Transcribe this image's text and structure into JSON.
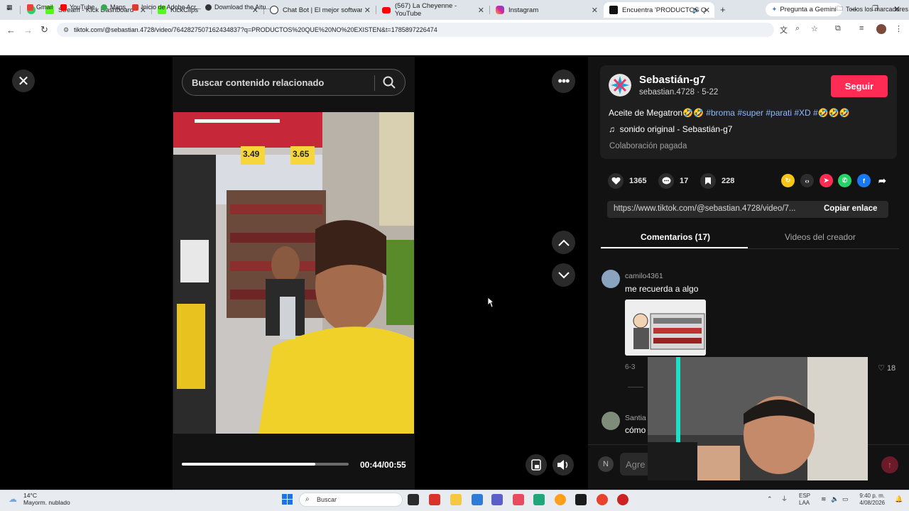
{
  "browser": {
    "tabs": [
      {
        "label": "Stream - Kick Dashboard",
        "color": "#53fc18"
      },
      {
        "label": "KickClips",
        "color": "#53fc18"
      },
      {
        "label": "Chat Bot | El mejor software pa",
        "color": "#222222"
      },
      {
        "label": "(567) La Cheyenne - YouTube",
        "color": "#ff0000"
      },
      {
        "label": "Instagram",
        "color": "#d6249f"
      },
      {
        "label": "Encuentra 'PRODUCTOS Q",
        "color": "#111111"
      }
    ],
    "gemini_label": "Pregunta a Gemini",
    "url": "tiktok.com/@sebastian.4728/video/7642827507162434837?q=PRODUCTOS%20QUE%20NO%20EXISTEN&t=1785897226474",
    "bookmarks": [
      "Gmail",
      "YouTube",
      "Maps",
      "Inicio de Adobe Acr...",
      "Download the Aitu..."
    ],
    "all_bookmarks": "Todos los marcadores"
  },
  "player": {
    "search_placeholder": "Buscar contenido relacionado",
    "time": "00:44/00:55",
    "progress": 0.8,
    "video_price_tags": [
      "3.49",
      "3.65"
    ]
  },
  "post": {
    "author": "Sebastián-g7",
    "handle_date": "sebastian.4728 · 5-22",
    "follow_label": "Seguir",
    "caption_text": "Aceite de Megatron🤣🤣",
    "caption_tags": "#broma #super #parati #XD #🤣🤣🤣",
    "sound": "sonido original - Sebastián-g7",
    "collab": "Colaboración pagada",
    "likes": "1365",
    "comments": "17",
    "saves": "228",
    "link": "https://www.tiktok.com/@sebastian.4728/video/7...",
    "copy_label": "Copiar enlace"
  },
  "tabs": {
    "comments": "Comentarios (17)",
    "creator_videos": "Videos del creador"
  },
  "comments": [
    {
      "user": "camilo4361",
      "text": "me recuerda a algo",
      "meta": "6-3",
      "likes": "18"
    },
    {
      "user": "Santia",
      "text": "cómo"
    }
  ],
  "input": {
    "initial": "N",
    "placeholder": "Agre"
  },
  "taskbar": {
    "temp": "14°C",
    "weather": "Mayorm. nublado",
    "search": "Buscar",
    "lang": "ESP\nLAA",
    "time": "9:40 p. m.",
    "date": "4/08/2026"
  }
}
